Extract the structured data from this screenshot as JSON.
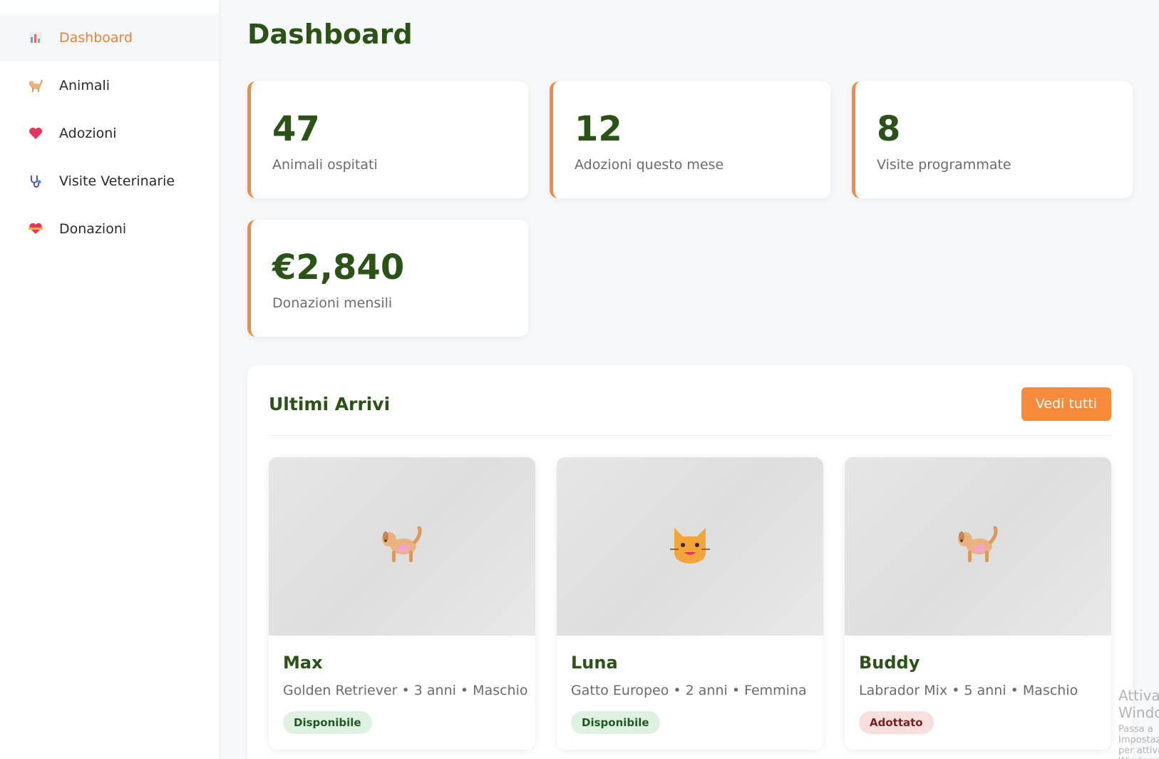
{
  "sidebar": {
    "items": [
      {
        "label": "Dashboard",
        "icon": "bar-chart-icon",
        "active": true
      },
      {
        "label": "Animali",
        "icon": "dog-icon"
      },
      {
        "label": "Adozioni",
        "icon": "heart-icon"
      },
      {
        "label": "Visite Veterinarie",
        "icon": "stethoscope-icon"
      },
      {
        "label": "Donazioni",
        "icon": "heart-ribbon-icon"
      }
    ]
  },
  "header": {
    "title": "Dashboard"
  },
  "stats": [
    {
      "value": "47",
      "label": "Animali ospitati"
    },
    {
      "value": "12",
      "label": "Adozioni questo mese"
    },
    {
      "value": "8",
      "label": "Visite programmate"
    },
    {
      "value": "€2,840",
      "label": "Donazioni mensili"
    }
  ],
  "arrivals": {
    "title": "Ultimi Arrivi",
    "button_label": "Vedi tutti",
    "animals": [
      {
        "name": "Max",
        "meta": "Golden Retriever • 3 anni • Maschio",
        "status": "Disponibile",
        "icon": "dog-icon"
      },
      {
        "name": "Luna",
        "meta": "Gatto Europeo • 2 anni • Femmina",
        "status": "Disponibile",
        "icon": "cat-face-icon"
      },
      {
        "name": "Buddy",
        "meta": "Labrador Mix • 5 anni • Maschio",
        "status": "Adottato",
        "icon": "dog-icon"
      }
    ]
  },
  "watermark": {
    "line1": "Attiva Windows",
    "line2": "Passa a Impostazioni per attivare Windows."
  },
  "colors": {
    "accent": "#f88a3c",
    "active_nav": "#f07f36",
    "heading": "#2b5217",
    "available_bg": "#dff2e2",
    "adopted_bg": "#f9dede"
  }
}
